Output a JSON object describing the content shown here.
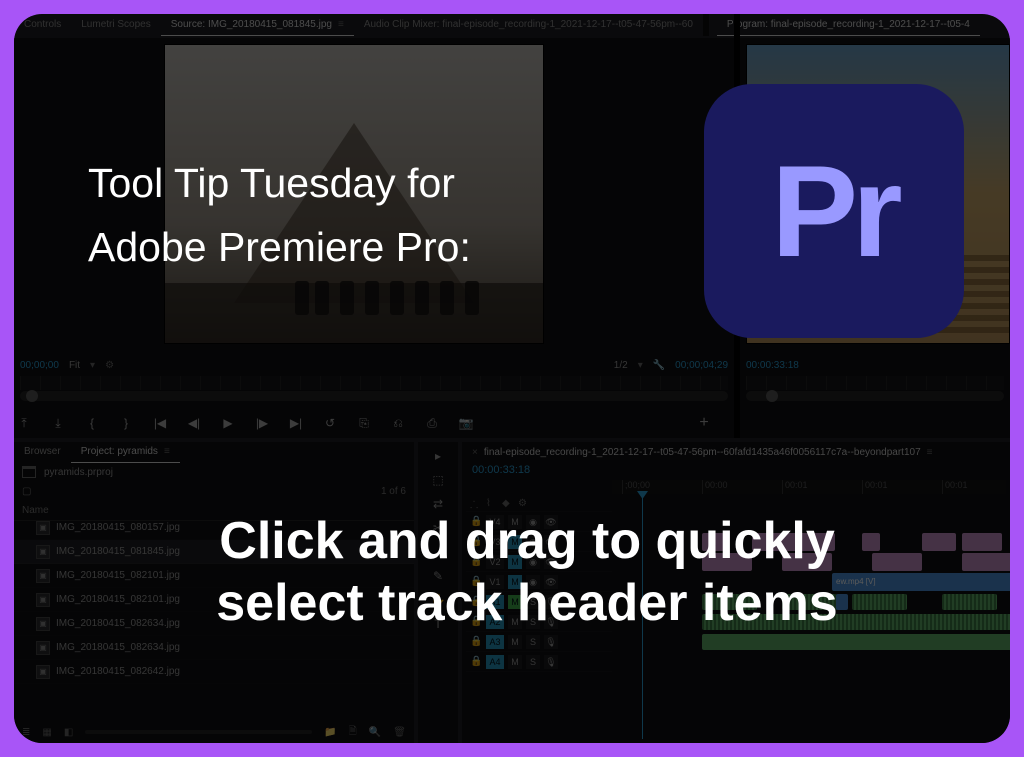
{
  "tabs": {
    "source_left1": "Controls",
    "source_left2": "Lumetri Scopes",
    "source_active": "Source: IMG_20180415_081845.jpg",
    "audio_mixer": "Audio Clip Mixer: final-episode_recording-1_2021-12-17--t05-47-56pm--60",
    "program": "Program: final-episode_recording-1_2021-12-17--t05-4"
  },
  "source": {
    "tc_in": "00;00;00",
    "fit": "Fit",
    "page": "1/2",
    "tc_out": "00;00;04;29"
  },
  "program": {
    "tc": "00:00:33:18"
  },
  "transport": {
    "icons": [
      "⤒",
      "⤓",
      "{",
      "}",
      "|◀◀",
      "◀|",
      "▶",
      "|▶",
      "▶▶|",
      "↺",
      "⎘",
      "⎌",
      "⎙",
      "📷"
    ]
  },
  "project": {
    "tab_browser": "Browser",
    "tab_active": "Project: pyramids",
    "file_meta": "pyramids.prproj",
    "count": "1 of 6",
    "col_name": "Name",
    "files": [
      "IMG_20180415_080157.jpg",
      "IMG_20180415_081845.jpg",
      "IMG_20180415_082101.jpg",
      "IMG_20180415_082101.jpg",
      "IMG_20180415_082634.jpg",
      "IMG_20180415_082634.jpg",
      "IMG_20180415_082642.jpg"
    ],
    "selected_index": 1
  },
  "tools": [
    "▸",
    "⬚",
    "✂",
    "↔",
    "✎",
    "T"
  ],
  "timeline": {
    "tab": "final-episode_recording-1_2021-12-17--t05-47-56pm--60fafd1435a46f0056117c7a--beyondpart107",
    "tc": "00:00:33:18",
    "ruler": [
      ";00;00",
      "00:00",
      "00:01",
      "00:01",
      "00:01",
      "00:0"
    ],
    "vtracks": [
      {
        "name": "V4",
        "mute": false
      },
      {
        "name": "V3",
        "mute": true
      },
      {
        "name": "V2",
        "mute": true
      },
      {
        "name": "V1",
        "mute": true
      }
    ],
    "atracks": [
      {
        "name": "A1",
        "sel": true,
        "mute": true,
        "solo": false
      },
      {
        "name": "A2",
        "sel": true,
        "mute": false,
        "solo": false
      },
      {
        "name": "A3",
        "sel": true,
        "mute": false,
        "solo": false
      },
      {
        "name": "A4",
        "sel": true,
        "mute": false,
        "solo": false
      }
    ],
    "clip_label_v": "ew.mp4 [V]"
  },
  "overlay": {
    "title_l1": "Tool Tip Tuesday for",
    "title_l2": "Adobe Premiere Pro:",
    "main_l1": "Click and drag to quickly",
    "main_l2": "select track header items"
  },
  "logo": "Pr"
}
